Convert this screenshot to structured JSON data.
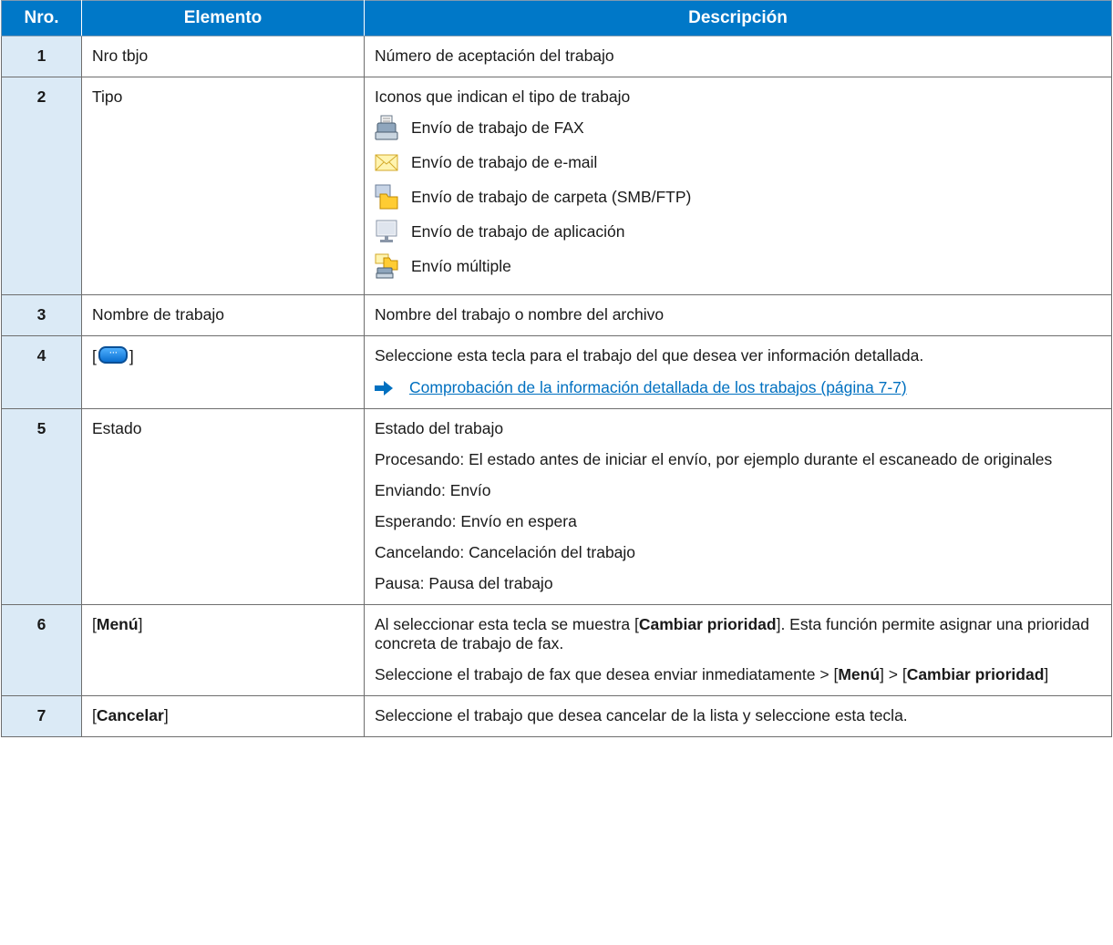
{
  "header": {
    "col_num": "Nro.",
    "col_element": "Elemento",
    "col_description": "Descripción"
  },
  "rows": [
    {
      "num": "1",
      "element": "Nro tbjo",
      "description": "Número de aceptación del trabajo"
    },
    {
      "num": "2",
      "element": "Tipo",
      "description": "Iconos que indican el tipo de trabajo",
      "icons": [
        {
          "icon": "fax-send-icon",
          "label": "Envío de trabajo de FAX"
        },
        {
          "icon": "email-send-icon",
          "label": "Envío de trabajo de e-mail"
        },
        {
          "icon": "folder-send-icon",
          "label": "Envío de trabajo de carpeta (SMB/FTP)"
        },
        {
          "icon": "application-send-icon",
          "label": "Envío de trabajo de aplicación"
        },
        {
          "icon": "multi-send-icon",
          "label": "Envío múltiple"
        }
      ]
    },
    {
      "num": "3",
      "element": "Nombre de trabajo",
      "description": "Nombre del trabajo o nombre del archivo"
    },
    {
      "num": "4",
      "element_open": "[",
      "element_close": "]",
      "element_icon": "detail-key-icon",
      "description": "Seleccione esta tecla para el trabajo del que desea ver información detallada.",
      "link": "Comprobación de la información detallada de los trabajos (página 7-7)"
    },
    {
      "num": "5",
      "element": "Estado",
      "lines": [
        "Estado del trabajo",
        "Procesando: El estado antes de iniciar el envío, por ejemplo durante el escaneado de originales",
        "Enviando: Envío",
        "Esperando: Envío en espera",
        "Cancelando: Cancelación del trabajo",
        "Pausa: Pausa del trabajo"
      ]
    },
    {
      "num": "6",
      "element_key": "Menú",
      "p1_a": "Al seleccionar esta tecla se muestra [",
      "p1_key": "Cambiar prioridad",
      "p1_b": "]. Esta función permite asignar una prioridad concreta de trabajo de fax.",
      "p2_a": "Seleccione el trabajo de fax que desea enviar inmediatamente > [",
      "p2_key1": "Menú",
      "p2_b": "] > [",
      "p2_key2": "Cambiar prioridad",
      "p2_c": "]"
    },
    {
      "num": "7",
      "element_key": "Cancelar",
      "description": "Seleccione el trabajo que desea cancelar de la lista y seleccione esta tecla."
    }
  ],
  "colors": {
    "header_bg": "#0078c8",
    "num_bg": "#dbeaf6",
    "link": "#0070c0"
  }
}
